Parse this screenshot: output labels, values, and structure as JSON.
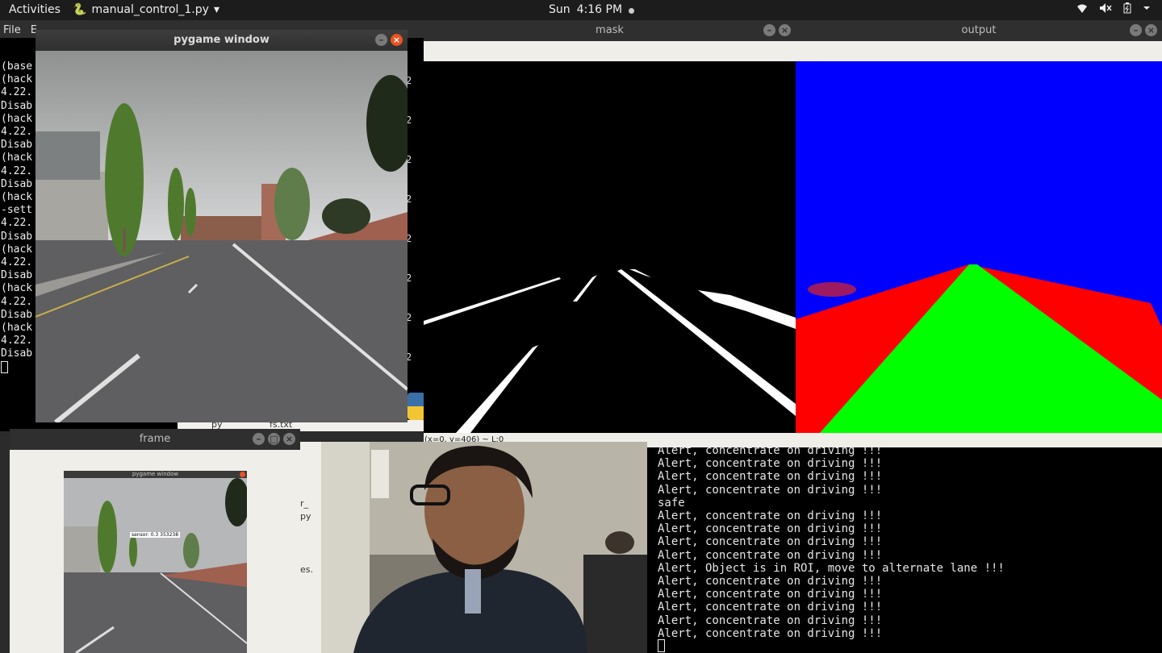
{
  "topbar": {
    "activities": "Activities",
    "app_name": "manual_control_1.py",
    "app_arrow": "▾",
    "day": "Sun",
    "time": "4:16 PM",
    "tray_icons": [
      "wifi-icon",
      "volume-mute-icon",
      "battery-icon",
      "system-menu-icon"
    ]
  },
  "bg_terminal": {
    "menu": [
      "File",
      "E"
    ],
    "lines": [
      "(base",
      "(hack",
      "4.22.",
      "Disab",
      "(hack",
      "4.22.",
      "Disab",
      "(hack",
      "4.22.",
      "Disab",
      "(hack",
      "-sett",
      "4.22.",
      "Disab",
      "(hack",
      "4.22.",
      "Disab",
      "(hack",
      "4.22.",
      "Disab",
      "(hack",
      "4.22.",
      "Disab"
    ],
    "right_digits": [
      "2",
      "2",
      "2",
      "2",
      "2",
      "2",
      "2",
      "2"
    ],
    "files": [
      "py",
      "fs.txt"
    ]
  },
  "peek_text": [
    "r_",
    "py",
    "es."
  ],
  "pygame_window": {
    "title": "pygame window"
  },
  "mask_window": {
    "title": "mask",
    "status": "(x=0, y=406) ~ L:0"
  },
  "output_window": {
    "title": "output"
  },
  "frame_window": {
    "title": "frame",
    "inner_title": "pygame window",
    "overlay_label": "sensor: 0.3  353238"
  },
  "terminal_output": {
    "lines": [
      "Alert, concentrate on driving !!!",
      "Alert, concentrate on driving !!!",
      "Alert, concentrate on driving !!!",
      "Alert, concentrate on driving !!!",
      "safe",
      "Alert, concentrate on driving !!!",
      "Alert, concentrate on driving !!!",
      "Alert, concentrate on driving !!!",
      "Alert, concentrate on driving !!!",
      "Alert, Object is in ROI, move to alternate lane !!!",
      "Alert, concentrate on driving !!!",
      "Alert, concentrate on driving !!!",
      "Alert, concentrate on driving !!!",
      "Alert, concentrate on driving !!!",
      "Alert, concentrate on driving !!!"
    ]
  },
  "colors": {
    "close_button": "#e95420",
    "segment_sky": "#0000ff",
    "segment_sidewalk": "#ff0000",
    "segment_road": "#00ff00"
  }
}
